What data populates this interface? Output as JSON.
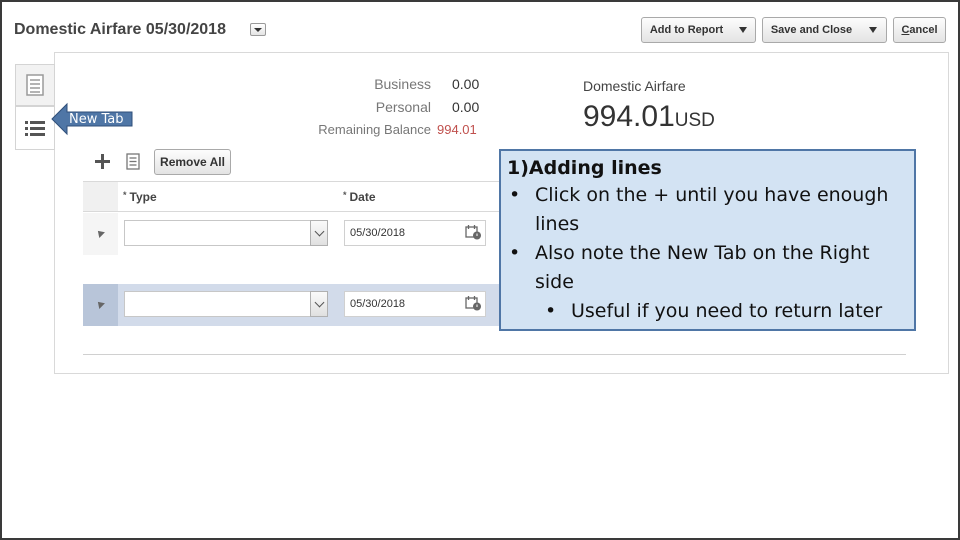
{
  "header": {
    "title": "Domestic Airfare 05/30/2018",
    "add_to_report": "Add to Report",
    "save_and_close": "Save and Close",
    "cancel_first": "C",
    "cancel_rest": "ancel"
  },
  "summary": {
    "business_label": "Business",
    "business_value": "0.00",
    "personal_label": "Personal",
    "personal_value": "0.00",
    "remaining_label": "Remaining Balance",
    "remaining_value": "994.01",
    "remaining_color": "#c0504d",
    "expense_type": "Domestic Airfare",
    "amount": "994.01",
    "currency": "USD"
  },
  "toolbar": {
    "remove_all": "Remove All"
  },
  "table": {
    "columns": [
      {
        "required_mark": "*",
        "label": "Type"
      },
      {
        "required_mark": "*",
        "label": "Date"
      }
    ],
    "rows": [
      {
        "type": "",
        "date": "05/30/2018",
        "selected": false
      },
      {
        "type": "",
        "date": "05/30/2018",
        "selected": true
      }
    ]
  },
  "annotation": {
    "arrow_label": "New Tab",
    "arrow_color": "#4f76a6",
    "heading": "1)Adding lines",
    "bullet1": "Click on the + until you have enough lines",
    "bullet2": "Also note the New Tab on the Right side",
    "sub_bullet": "Useful if you need to return later"
  }
}
